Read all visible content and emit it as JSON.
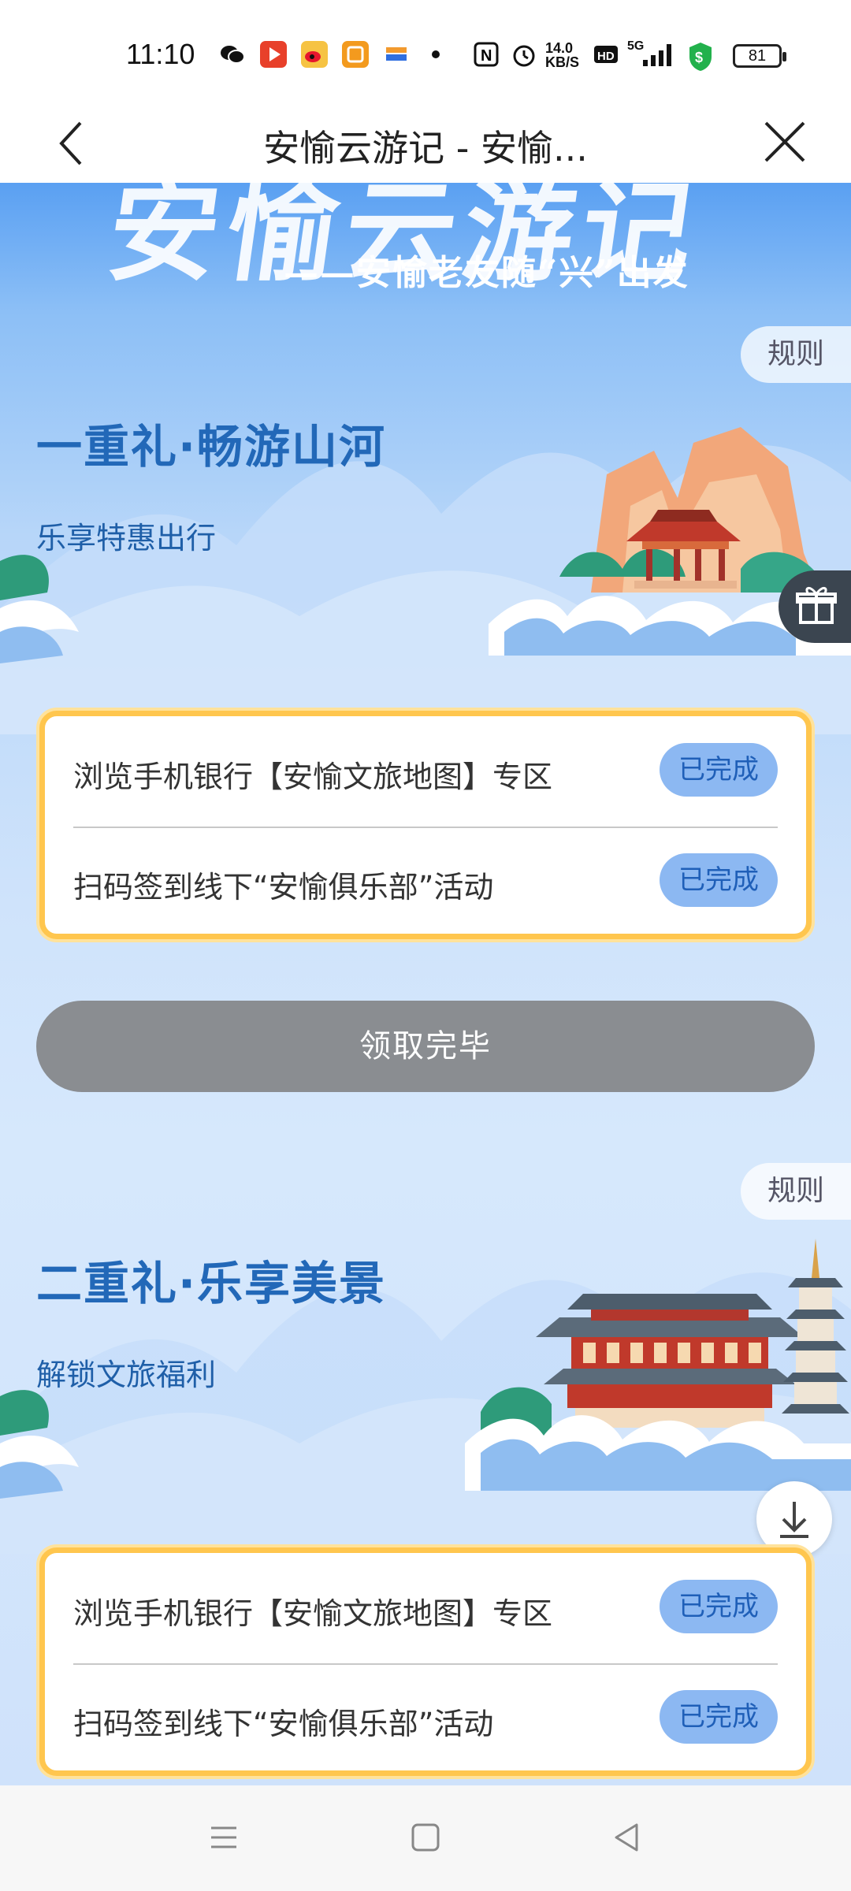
{
  "status_bar": {
    "time": "11:10",
    "net_speed": "14.0 KB/S",
    "network": "5G",
    "battery": "81"
  },
  "titlebar": {
    "title": "安愉云游记 - 安愉..."
  },
  "banner": {
    "script_title": "安愉云游记",
    "subtitle": "——安愉老友随“兴”出发"
  },
  "section1": {
    "rule": "规则",
    "title": "一重礼·畅游山河",
    "subtitle": "乐享特惠出行",
    "tasks": [
      {
        "label": "浏览手机银行【安愉文旅地图】专区",
        "status": "已完成"
      },
      {
        "label": "扫码签到线下“安愉俱乐部”活动",
        "status": "已完成"
      }
    ],
    "claim_button": "领取完毕"
  },
  "section2": {
    "rule": "规则",
    "title": "二重礼·乐享美景",
    "subtitle": "解锁文旅福利",
    "tasks": [
      {
        "label": "浏览手机银行【安愉文旅地图】专区",
        "status": "已完成"
      },
      {
        "label": "扫码签到线下“安愉俱乐部”活动",
        "status": "已完成"
      }
    ]
  },
  "colors": {
    "title_blue": "#2268b8",
    "card_border": "#ffc64e",
    "done_pill": "#8cb8f2",
    "claim_disabled": "#8a8d91"
  },
  "icons": [
    "back-icon",
    "close-icon",
    "gift-icon",
    "download-icon",
    "menu-icon",
    "home-icon",
    "back-nav-icon"
  ]
}
